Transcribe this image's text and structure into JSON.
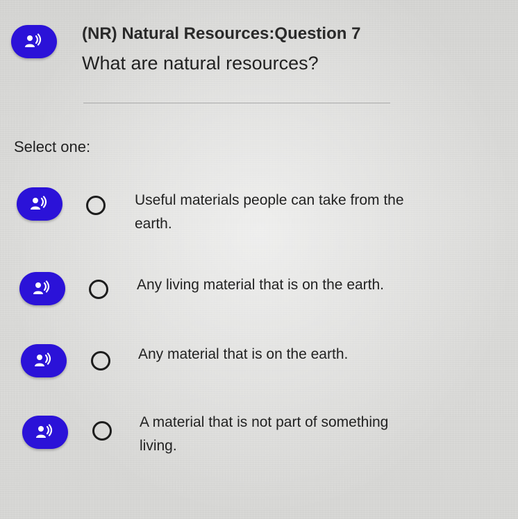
{
  "question": {
    "title": "(NR) Natural Resources:Question 7",
    "text": "What are natural resources?",
    "audio_icon": "speaker-person-icon"
  },
  "prompt": "Select one:",
  "options": [
    {
      "label": "Useful materials people can take from the earth."
    },
    {
      "label": "Any living material that is on the earth."
    },
    {
      "label": "Any material that is on the earth."
    },
    {
      "label": "A material that is not part of something living."
    }
  ],
  "colors": {
    "audio_button": "#2b12d8",
    "background": "#d9d9d7"
  }
}
